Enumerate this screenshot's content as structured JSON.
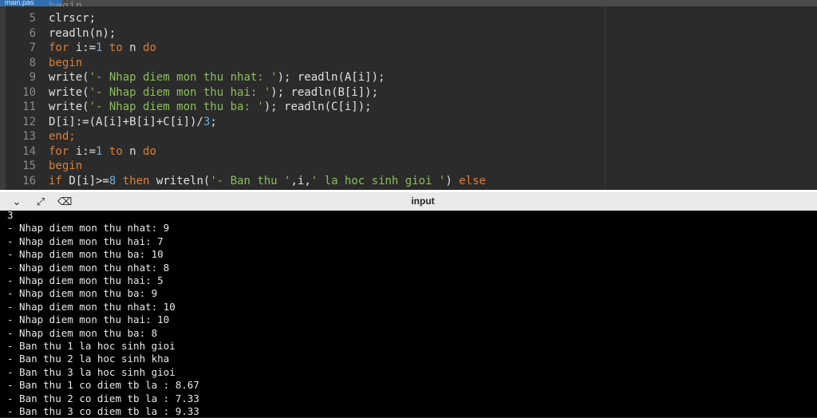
{
  "tab": {
    "label": "main.pas"
  },
  "editor": {
    "partial_top": "begin",
    "lines": [
      {
        "num": "5",
        "tokens": [
          {
            "t": "clrscr;",
            "c": ""
          }
        ]
      },
      {
        "num": "6",
        "tokens": [
          {
            "t": "readln(n);",
            "c": ""
          }
        ]
      },
      {
        "num": "7",
        "tokens": [
          {
            "t": "for",
            "c": "kw"
          },
          {
            "t": " i:=",
            "c": ""
          },
          {
            "t": "1",
            "c": "num"
          },
          {
            "t": " ",
            "c": ""
          },
          {
            "t": "to",
            "c": "kw"
          },
          {
            "t": " n ",
            "c": ""
          },
          {
            "t": "do",
            "c": "kw"
          }
        ]
      },
      {
        "num": "8",
        "tokens": [
          {
            "t": "begin",
            "c": "kw"
          }
        ]
      },
      {
        "num": "9",
        "tokens": [
          {
            "t": "write(",
            "c": ""
          },
          {
            "t": "'- Nhap diem mon thu nhat: '",
            "c": "str"
          },
          {
            "t": "); readln(A[i]);",
            "c": ""
          }
        ]
      },
      {
        "num": "10",
        "tokens": [
          {
            "t": "write(",
            "c": ""
          },
          {
            "t": "'- Nhap diem mon thu hai: '",
            "c": "str"
          },
          {
            "t": "); readln(B[i]);",
            "c": ""
          }
        ]
      },
      {
        "num": "11",
        "tokens": [
          {
            "t": "write(",
            "c": ""
          },
          {
            "t": "'- Nhap diem mon thu ba: '",
            "c": "str"
          },
          {
            "t": "); readln(C[i]);",
            "c": ""
          }
        ]
      },
      {
        "num": "12",
        "tokens": [
          {
            "t": "D[i]:=(A[i]+B[i]+C[i])/",
            "c": ""
          },
          {
            "t": "3",
            "c": "num"
          },
          {
            "t": ";",
            "c": ""
          }
        ]
      },
      {
        "num": "13",
        "tokens": [
          {
            "t": "end;",
            "c": "kw"
          }
        ]
      },
      {
        "num": "14",
        "tokens": [
          {
            "t": "for",
            "c": "kw"
          },
          {
            "t": " i:=",
            "c": ""
          },
          {
            "t": "1",
            "c": "num"
          },
          {
            "t": " ",
            "c": ""
          },
          {
            "t": "to",
            "c": "kw"
          },
          {
            "t": " n ",
            "c": ""
          },
          {
            "t": "do",
            "c": "kw"
          }
        ]
      },
      {
        "num": "15",
        "tokens": [
          {
            "t": "begin",
            "c": "kw"
          }
        ]
      },
      {
        "num": "16",
        "tokens": [
          {
            "t": "if",
            "c": "kw"
          },
          {
            "t": " D[i]>=",
            "c": ""
          },
          {
            "t": "8",
            "c": "num"
          },
          {
            "t": " ",
            "c": ""
          },
          {
            "t": "then",
            "c": "kw"
          },
          {
            "t": " writeln(",
            "c": ""
          },
          {
            "t": "'- Ban thu '",
            "c": "str"
          },
          {
            "t": ",i,",
            "c": ""
          },
          {
            "t": "' la hoc sinh gioi '",
            "c": "str"
          },
          {
            "t": ") ",
            "c": ""
          },
          {
            "t": "else",
            "c": "kw"
          }
        ]
      }
    ]
  },
  "panel": {
    "title": "input",
    "icons": [
      "chevron-down-icon",
      "expand-icon",
      "clear-icon"
    ]
  },
  "console": {
    "lines": [
      "3",
      "- Nhap diem mon thu nhat: 9",
      "- Nhap diem mon thu hai: 7",
      "- Nhap diem mon thu ba: 10",
      "- Nhap diem mon thu nhat: 8",
      "- Nhap diem mon thu hai: 5",
      "- Nhap diem mon thu ba: 9",
      "- Nhap diem mon thu nhat: 10",
      "- Nhap diem mon thu hai: 10",
      "- Nhap diem mon thu ba: 8",
      "- Ban thu 1 la hoc sinh gioi",
      "- Ban thu 2 la hoc sinh kha",
      "- Ban thu 3 la hoc sinh gioi",
      "- Ban thu 1 co diem tb la : 8.67",
      "- Ban thu 2 co diem tb la : 7.33",
      "- Ban thu 3 co diem tb la : 9.33"
    ]
  },
  "colors": {
    "keyword": "#d7803a",
    "number": "#6fb0e0",
    "string": "#8bbf5a",
    "text": "#e0e0e0",
    "console_bg": "#000000"
  }
}
